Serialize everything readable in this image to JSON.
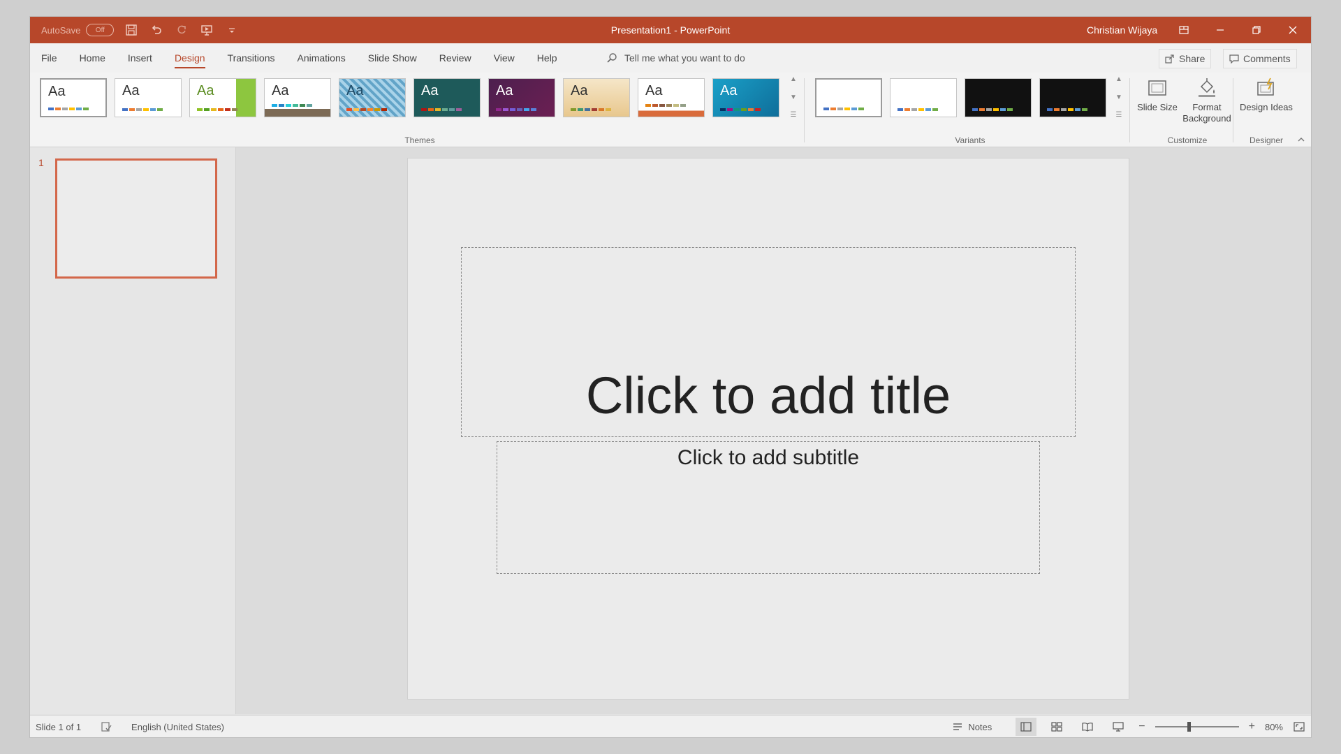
{
  "app": {
    "autosave_label": "AutoSave",
    "autosave_state": "Off",
    "document_title": "Presentation1 - PowerPoint",
    "user_name": "Christian Wijaya"
  },
  "menu": {
    "tabs": [
      "File",
      "Home",
      "Insert",
      "Design",
      "Transitions",
      "Animations",
      "Slide Show",
      "Review",
      "View",
      "Help"
    ],
    "active_tab": "Design",
    "tell_me_placeholder": "Tell me what you want to do",
    "share_label": "Share",
    "comments_label": "Comments"
  },
  "ribbon": {
    "themes_label": "Themes",
    "variants_label": "Variants",
    "customize_label": "Customize",
    "designer_label": "Designer",
    "theme_glyph": "Aa",
    "slide_size_label": "Slide Size",
    "format_background_label": "Format Background",
    "design_ideas_label": "Design Ideas"
  },
  "slides": {
    "number": "1"
  },
  "slide": {
    "title_placeholder": "Click to add title",
    "subtitle_placeholder": "Click to add subtitle"
  },
  "status": {
    "slide_info": "Slide 1 of 1",
    "language": "English (United States)",
    "notes_label": "Notes",
    "zoom_level": "80%",
    "zoom_fraction": 0.4
  },
  "colors": {
    "accent": "#b7472a",
    "thumb_border": "#d3674a"
  }
}
